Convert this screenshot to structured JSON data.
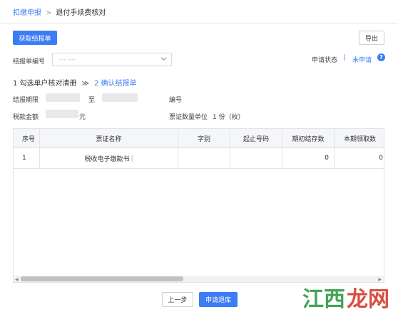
{
  "breadcrumb": {
    "parent": "扣缴申报",
    "separator": ">",
    "current": "退付手续费核对"
  },
  "toolbar": {
    "fetch_button": "获取结报单",
    "export_button": "导出"
  },
  "filter": {
    "label": "结报单编号",
    "select_value": "--- ---"
  },
  "status": {
    "label": "申请状态",
    "separator": "|",
    "value": "未申请"
  },
  "steps": {
    "step1": "1 勾选单户核对清册",
    "separator": "≫",
    "step2": "2 确认结报单"
  },
  "info": {
    "period_label": "结报期限",
    "to_label": "至",
    "number_label": "编号",
    "amount_label": "税款金额",
    "amount_unit": "元",
    "voucher_unit_label": "票证数量单位",
    "voucher_unit_value": "1 份（枚）"
  },
  "table": {
    "columns": [
      "序号",
      "票证名称",
      "字别",
      "起止号码",
      "期初结存数",
      "本期领取数"
    ],
    "rows": [
      [
        "1",
        "税收电子缴款书",
        "",
        "",
        "0",
        "0"
      ]
    ]
  },
  "footer": {
    "prev_button": "上一步",
    "submit_button": "申请退库"
  },
  "watermark": {
    "text": "江西龙网"
  },
  "colors": {
    "accent": "#3d7cf4",
    "watermark_green": "#2f9a45",
    "watermark_red": "#d23b2e"
  }
}
